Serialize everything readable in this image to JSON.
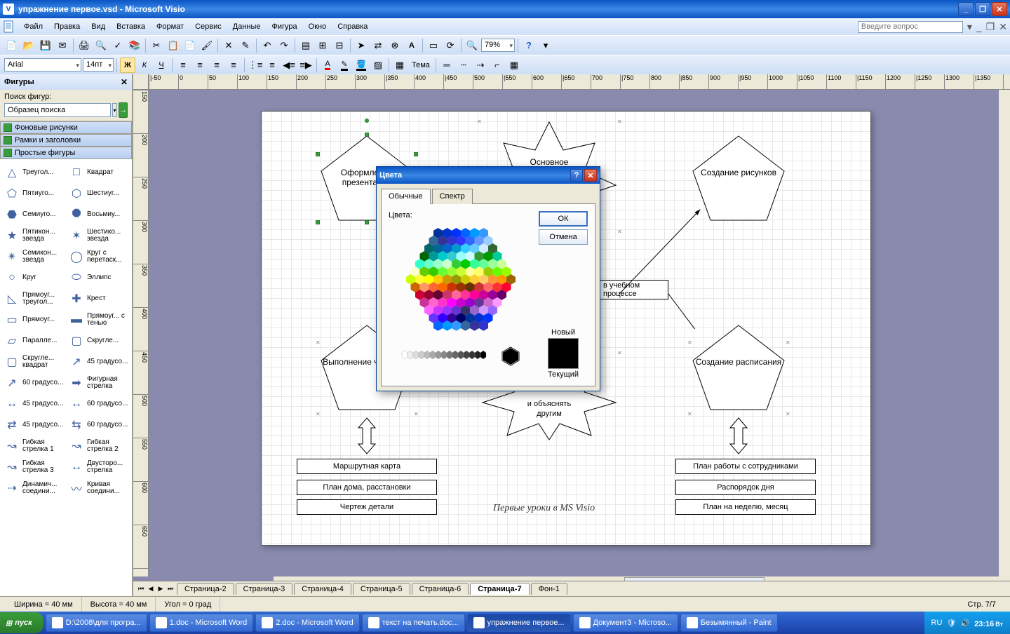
{
  "titlebar": {
    "title": "упражнение первое.vsd - Microsoft Visio"
  },
  "menu": {
    "items": [
      "Файл",
      "Правка",
      "Вид",
      "Вставка",
      "Формат",
      "Сервис",
      "Данные",
      "Фигура",
      "Окно",
      "Справка"
    ],
    "help_placeholder": "Введите вопрос"
  },
  "toolbar2": {
    "font": "Arial",
    "size": "14пт",
    "theme_label": "Тема"
  },
  "toolbar1": {
    "zoom": "79%"
  },
  "shapes_panel": {
    "title": "Фигуры",
    "search_label": "Поиск фигур:",
    "search_placeholder": "Образец поиска",
    "stencils": [
      "Фоновые рисунки",
      "Рамки и заголовки",
      "Простые фигуры"
    ],
    "shapes": [
      "Треугол...",
      "Квадрат",
      "Пятиуго...",
      "Шестиуг...",
      "Семиуго...",
      "Восьмиу...",
      "Пятикон... звезда",
      "Шестико... звезда",
      "Семикон... звезда",
      "Круг с перетаск...",
      "Круг",
      "Эллипс",
      "Прямоуг... треугол...",
      "Крест",
      "Прямоуг...",
      "Прямоуг... с тенью",
      "Паралле...",
      "Скругле...",
      "Скругле... квадрат",
      "45 градусо...",
      "60 градусо...",
      "Фигурная стрелка",
      "45 градусо...",
      "60 градусо...",
      "45 градусо...",
      "60 градусо...",
      "Гибкая стрелка 1",
      "Гибкая стрелка 2",
      "Гибкая стрелка 3",
      "Двусторо... стрелка",
      "Динамич... соедини...",
      "Кривая соедини..."
    ]
  },
  "canvas": {
    "shapes": {
      "pentagon1": "Оформление презентаций",
      "pentagon2": "Создание рисунков",
      "pentagon3": "Выполнение чертежей",
      "pentagon4": "Создание расписания",
      "star1": "Основное",
      "star2_line1": "и объяснять",
      "star2_line2": "другим",
      "rect_center": "в учебном процессе",
      "rects_left": [
        "Маршрутная карта",
        "План дома, расстановки",
        "Чертеж детали"
      ],
      "rects_right": [
        "План работы с сотрудниками",
        "Распорядок дня",
        "План на неделю, месяц"
      ],
      "caption": "Первые уроки в MS Visio"
    },
    "ruler_ticks_h": [
      "|-50",
      "0",
      "50",
      "100",
      "150",
      "200",
      "250",
      "300",
      "|350",
      "400",
      "|450",
      "500",
      "|550",
      "600",
      "|650",
      "700",
      "|750",
      "800",
      "|850",
      "900",
      "|950",
      "1000",
      "|1050",
      "1100",
      "|1150",
      "1200",
      "|1250",
      "1300",
      "|1350"
    ],
    "ruler_ticks_v": [
      "150",
      "200",
      "250",
      "300",
      "350",
      "400",
      "450",
      "500",
      "550",
      "600",
      "650"
    ]
  },
  "dialog": {
    "title": "Цвета",
    "tabs": [
      "Обычные",
      "Спектр"
    ],
    "label_colors": "Цвета:",
    "btn_ok": "ОК",
    "btn_cancel": "Отмена",
    "label_new": "Новый",
    "label_current": "Текущий"
  },
  "tabs": {
    "pages": [
      "Страница-2",
      "Страница-3",
      "Страница-4",
      "Страница-5",
      "Страница-6",
      "Страница-7",
      "Фон-1"
    ],
    "active": "Страница-7"
  },
  "statusbar": {
    "width": "Ширина = 40 мм",
    "height": "Высота = 40 мм",
    "angle": "Угол = 0 град",
    "page": "Стр. 7/7"
  },
  "taskbar": {
    "start": "пуск",
    "items": [
      "D:\\2008\\для програ...",
      "1.doc - Microsoft Word",
      "2.doc - Microsoft Word",
      "текст на печать.doc...",
      "упражнение первое...",
      "Документ3 - Microso...",
      "Безымянный - Paint"
    ],
    "active_index": 4,
    "clock": "23:16",
    "day": "Вт"
  }
}
